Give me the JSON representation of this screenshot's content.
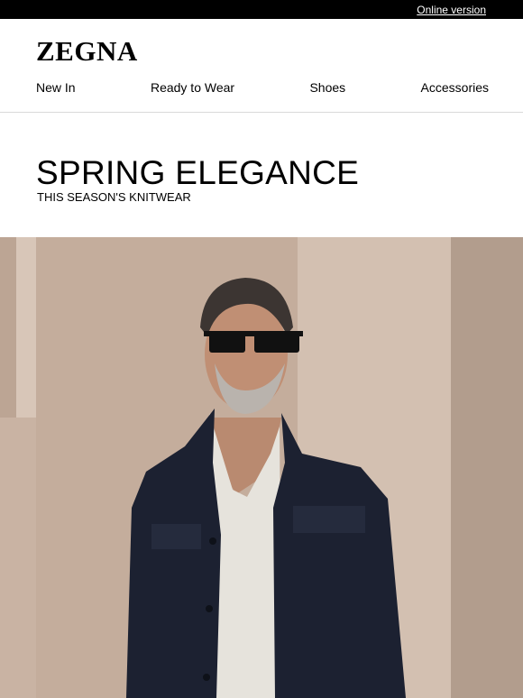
{
  "topbar": {
    "online_version": "Online version"
  },
  "brand": {
    "logo_text": "ZEGNA"
  },
  "nav": {
    "items": [
      {
        "label": "New In"
      },
      {
        "label": "Ready to Wear"
      },
      {
        "label": "Shoes"
      },
      {
        "label": "Accessories"
      }
    ]
  },
  "intro": {
    "title": "SPRING ELEGANCE",
    "subtitle": "THIS SEASON'S KNITWEAR"
  },
  "colors": {
    "background": "#ffffff",
    "topbar": "#000000",
    "wall": "#c7b09f",
    "jacket": "#1c2131"
  }
}
